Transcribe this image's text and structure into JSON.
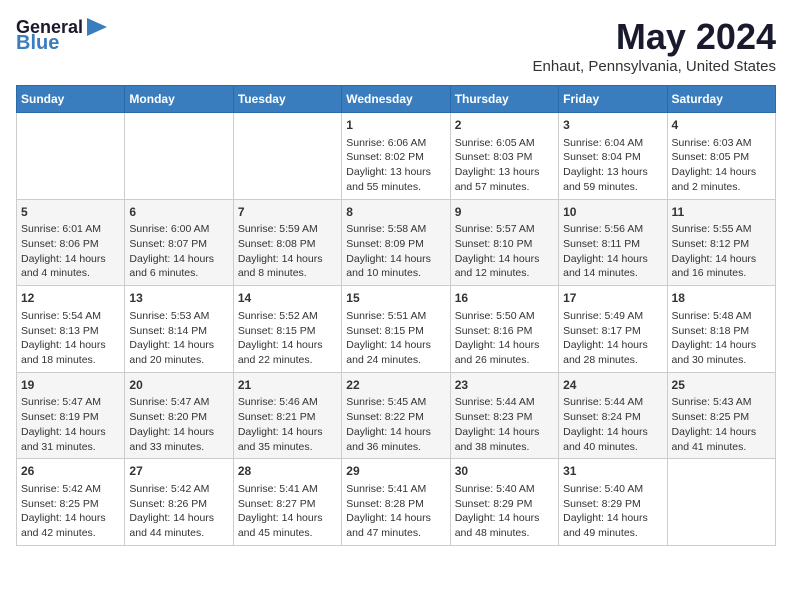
{
  "logo": {
    "general": "General",
    "blue": "Blue",
    "arrow": "▶"
  },
  "title": "May 2024",
  "subtitle": "Enhaut, Pennsylvania, United States",
  "headers": [
    "Sunday",
    "Monday",
    "Tuesday",
    "Wednesday",
    "Thursday",
    "Friday",
    "Saturday"
  ],
  "weeks": [
    [
      {
        "day": "",
        "content": ""
      },
      {
        "day": "",
        "content": ""
      },
      {
        "day": "",
        "content": ""
      },
      {
        "day": "1",
        "content": "Sunrise: 6:06 AM\nSunset: 8:02 PM\nDaylight: 13 hours\nand 55 minutes."
      },
      {
        "day": "2",
        "content": "Sunrise: 6:05 AM\nSunset: 8:03 PM\nDaylight: 13 hours\nand 57 minutes."
      },
      {
        "day": "3",
        "content": "Sunrise: 6:04 AM\nSunset: 8:04 PM\nDaylight: 13 hours\nand 59 minutes."
      },
      {
        "day": "4",
        "content": "Sunrise: 6:03 AM\nSunset: 8:05 PM\nDaylight: 14 hours\nand 2 minutes."
      }
    ],
    [
      {
        "day": "5",
        "content": "Sunrise: 6:01 AM\nSunset: 8:06 PM\nDaylight: 14 hours\nand 4 minutes."
      },
      {
        "day": "6",
        "content": "Sunrise: 6:00 AM\nSunset: 8:07 PM\nDaylight: 14 hours\nand 6 minutes."
      },
      {
        "day": "7",
        "content": "Sunrise: 5:59 AM\nSunset: 8:08 PM\nDaylight: 14 hours\nand 8 minutes."
      },
      {
        "day": "8",
        "content": "Sunrise: 5:58 AM\nSunset: 8:09 PM\nDaylight: 14 hours\nand 10 minutes."
      },
      {
        "day": "9",
        "content": "Sunrise: 5:57 AM\nSunset: 8:10 PM\nDaylight: 14 hours\nand 12 minutes."
      },
      {
        "day": "10",
        "content": "Sunrise: 5:56 AM\nSunset: 8:11 PM\nDaylight: 14 hours\nand 14 minutes."
      },
      {
        "day": "11",
        "content": "Sunrise: 5:55 AM\nSunset: 8:12 PM\nDaylight: 14 hours\nand 16 minutes."
      }
    ],
    [
      {
        "day": "12",
        "content": "Sunrise: 5:54 AM\nSunset: 8:13 PM\nDaylight: 14 hours\nand 18 minutes."
      },
      {
        "day": "13",
        "content": "Sunrise: 5:53 AM\nSunset: 8:14 PM\nDaylight: 14 hours\nand 20 minutes."
      },
      {
        "day": "14",
        "content": "Sunrise: 5:52 AM\nSunset: 8:15 PM\nDaylight: 14 hours\nand 22 minutes."
      },
      {
        "day": "15",
        "content": "Sunrise: 5:51 AM\nSunset: 8:15 PM\nDaylight: 14 hours\nand 24 minutes."
      },
      {
        "day": "16",
        "content": "Sunrise: 5:50 AM\nSunset: 8:16 PM\nDaylight: 14 hours\nand 26 minutes."
      },
      {
        "day": "17",
        "content": "Sunrise: 5:49 AM\nSunset: 8:17 PM\nDaylight: 14 hours\nand 28 minutes."
      },
      {
        "day": "18",
        "content": "Sunrise: 5:48 AM\nSunset: 8:18 PM\nDaylight: 14 hours\nand 30 minutes."
      }
    ],
    [
      {
        "day": "19",
        "content": "Sunrise: 5:47 AM\nSunset: 8:19 PM\nDaylight: 14 hours\nand 31 minutes."
      },
      {
        "day": "20",
        "content": "Sunrise: 5:47 AM\nSunset: 8:20 PM\nDaylight: 14 hours\nand 33 minutes."
      },
      {
        "day": "21",
        "content": "Sunrise: 5:46 AM\nSunset: 8:21 PM\nDaylight: 14 hours\nand 35 minutes."
      },
      {
        "day": "22",
        "content": "Sunrise: 5:45 AM\nSunset: 8:22 PM\nDaylight: 14 hours\nand 36 minutes."
      },
      {
        "day": "23",
        "content": "Sunrise: 5:44 AM\nSunset: 8:23 PM\nDaylight: 14 hours\nand 38 minutes."
      },
      {
        "day": "24",
        "content": "Sunrise: 5:44 AM\nSunset: 8:24 PM\nDaylight: 14 hours\nand 40 minutes."
      },
      {
        "day": "25",
        "content": "Sunrise: 5:43 AM\nSunset: 8:25 PM\nDaylight: 14 hours\nand 41 minutes."
      }
    ],
    [
      {
        "day": "26",
        "content": "Sunrise: 5:42 AM\nSunset: 8:25 PM\nDaylight: 14 hours\nand 42 minutes."
      },
      {
        "day": "27",
        "content": "Sunrise: 5:42 AM\nSunset: 8:26 PM\nDaylight: 14 hours\nand 44 minutes."
      },
      {
        "day": "28",
        "content": "Sunrise: 5:41 AM\nSunset: 8:27 PM\nDaylight: 14 hours\nand 45 minutes."
      },
      {
        "day": "29",
        "content": "Sunrise: 5:41 AM\nSunset: 8:28 PM\nDaylight: 14 hours\nand 47 minutes."
      },
      {
        "day": "30",
        "content": "Sunrise: 5:40 AM\nSunset: 8:29 PM\nDaylight: 14 hours\nand 48 minutes."
      },
      {
        "day": "31",
        "content": "Sunrise: 5:40 AM\nSunset: 8:29 PM\nDaylight: 14 hours\nand 49 minutes."
      },
      {
        "day": "",
        "content": ""
      }
    ]
  ]
}
